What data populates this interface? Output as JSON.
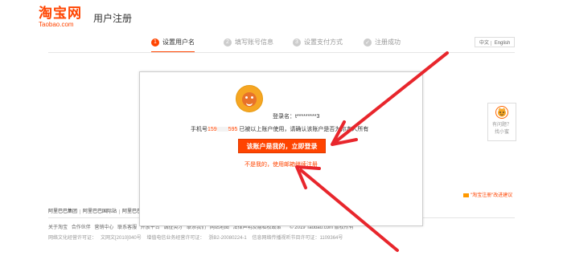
{
  "header": {
    "logo_cn": "淘宝网",
    "logo_en": "Taobao.com",
    "page_title": "用户注册"
  },
  "steps": [
    {
      "num": "1",
      "label": "设置用户名",
      "state": "active"
    },
    {
      "num": "2",
      "label": "填写账号信息",
      "state": "pending"
    },
    {
      "num": "3",
      "label": "设置支付方式",
      "state": "pending"
    },
    {
      "num": "✓",
      "label": "注册成功",
      "state": "pending"
    }
  ],
  "language": {
    "zh": "中文",
    "en": "English"
  },
  "helper": {
    "line1": "有问题？",
    "line2": "找小蜜"
  },
  "feedback": "\"淘宝注册\"改进建议",
  "modal": {
    "login_name": "登录名：t*********3",
    "phone_prefix": "手机号",
    "phone_start": "159",
    "phone_end": "595",
    "phone_suffix": "已被以上账户使用，请确认该账户是否为你本人所有",
    "confirm_button": "该账户是我的，立即登录",
    "not_mine_link": "不是我的，使用邮箱继续注册"
  },
  "footer": {
    "groups": [
      "阿里巴巴集团",
      "阿里巴巴国际站",
      "阿里巴巴"
    ],
    "links": [
      "关于淘宝",
      "合作伙伴",
      "营销中心",
      "联系客服",
      "开放平台",
      "诚征英才",
      "联系我们",
      "网站地图",
      "法律声明及隐私权政策"
    ],
    "copyright": "© 2019 Taobao.com 版权所有",
    "license": [
      "网络文化经营许可证：",
      "文网文[2010]040号",
      "增值电信业务经营许可证：",
      "浙B2-20080224-1",
      "信息网络传播视听节目许可证：1109364号"
    ]
  },
  "colors": {
    "accent": "#ff4400",
    "arrow": "#e8262c"
  },
  "icons": {
    "helper": "mascot-icon",
    "avatar": "mascot-avatar-icon",
    "feedback": "feedback-icon"
  }
}
